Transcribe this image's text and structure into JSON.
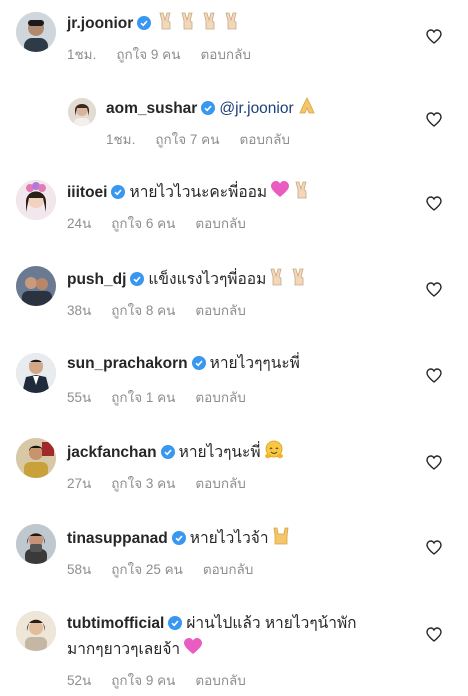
{
  "comments": [
    {
      "username": "jr.joonior",
      "text": "",
      "emoji": "victory-hand x4",
      "time": "1ชม.",
      "likes": "ถูกใจ 9 คน",
      "reply": "ตอบกลับ"
    },
    {
      "username": "aom_sushar",
      "mention": "@jr.joonior",
      "emoji": "folded-hands",
      "time": "1ชม.",
      "likes": "ถูกใจ 7 คน",
      "reply": "ตอบกลับ"
    },
    {
      "username": "iiitoei",
      "text": "หายไวไวนะคะพี่ออม",
      "emoji": "sparkling-heart, victory-hand",
      "time": "24น",
      "likes": "ถูกใจ 6 คน",
      "reply": "ตอบกลับ"
    },
    {
      "username": "push_dj",
      "text": "แข็งแรงไวๆพี่ออม",
      "emoji": "victory-hand x2",
      "time": "38น",
      "likes": "ถูกใจ 8 คน",
      "reply": "ตอบกลับ"
    },
    {
      "username": "sun_prachakorn",
      "text": "หายไวๆๆนะพี่",
      "time": "55น",
      "likes": "ถูกใจ 1 คน",
      "reply": "ตอบกลับ"
    },
    {
      "username": "jackfanchan",
      "text": "หายไวๆนะพี่",
      "emoji": "hugging-face",
      "time": "27น",
      "likes": "ถูกใจ 3 คน",
      "reply": "ตอบกลับ"
    },
    {
      "username": "tinasuppanad",
      "text": "หายไวไวจ้า",
      "emoji": "sign-of-horns",
      "time": "58น",
      "likes": "ถูกใจ 25 คน",
      "reply": "ตอบกลับ"
    },
    {
      "username": "tubtimofficial",
      "text": "ผ่านไปแล้ว หายไวๆน้าพัก",
      "text_line2": "มากๆยาวๆเลยจ้า",
      "emoji": "sparkling-heart",
      "time": "52น",
      "likes": "ถูกใจ 9 คน",
      "reply": "ตอบกลับ"
    }
  ],
  "colors": {
    "text": "#262626",
    "meta": "#8e8e8e",
    "verified": "#3897f0",
    "mention": "#1d3f79",
    "heart_outline": "#262626"
  },
  "icons": {
    "like": "heart-outline-icon",
    "verified": "verified-badge-icon"
  }
}
